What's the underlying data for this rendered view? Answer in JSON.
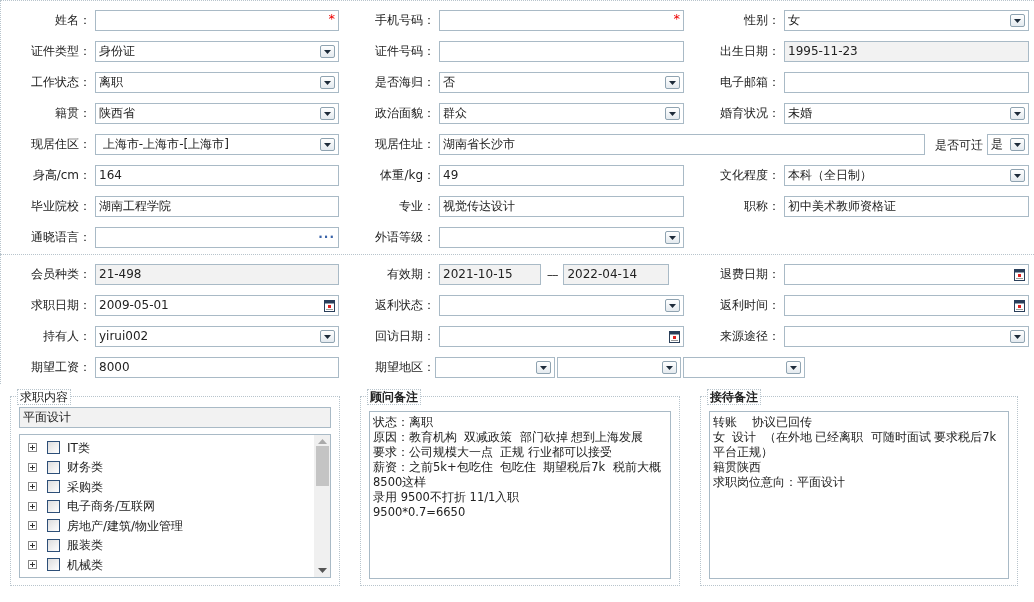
{
  "personal": {
    "fields": [
      {
        "label": "姓名：",
        "kind": "text",
        "required_mark": "*"
      },
      {
        "label": "手机号码：",
        "kind": "text",
        "required_mark": "*"
      },
      {
        "label": "性别：",
        "kind": "select",
        "value": "女"
      },
      {
        "label": "证件类型：",
        "kind": "select",
        "value": "身份证"
      },
      {
        "label": "证件号码：",
        "kind": "text"
      },
      {
        "label": "出生日期：",
        "kind": "text",
        "value": "1995-11-23",
        "readonly": true
      },
      {
        "label": "工作状态：",
        "kind": "select",
        "value": "离职"
      },
      {
        "label": "是否海归：",
        "kind": "select",
        "value": "否"
      },
      {
        "label": "电子邮箱：",
        "kind": "text"
      },
      {
        "label": "籍贯：",
        "kind": "select",
        "value": "陕西省"
      },
      {
        "label": "政治面貌：",
        "kind": "select",
        "value": "群众"
      },
      {
        "label": "婚育状况：",
        "kind": "select",
        "value": "未婚"
      },
      {
        "label": "现居住区：",
        "kind": "select",
        "value": " 上海市-上海市-[上海市]"
      },
      {
        "label": "现居住址：",
        "kind": "address",
        "value": "湖南省长沙市",
        "relocate": {
          "label": "是否可迁",
          "value": "是"
        }
      },
      {
        "label": "身高/cm：",
        "kind": "text",
        "value": "164"
      },
      {
        "label": "体重/kg：",
        "kind": "text",
        "value": "49"
      },
      {
        "label": "文化程度：",
        "kind": "select",
        "value": "本科（全日制）"
      },
      {
        "label": "毕业院校：",
        "kind": "text",
        "value": "湖南工程学院"
      },
      {
        "label": "专业：",
        "kind": "text",
        "value": "视觉传达设计"
      },
      {
        "label": "职称：",
        "kind": "text",
        "value": "初中美术教师资格证"
      },
      {
        "label": "通晓语言：",
        "kind": "lookup",
        "button": "···"
      },
      {
        "label": "外语等级：",
        "kind": "select"
      }
    ]
  },
  "membership": {
    "fields": [
      {
        "label": "会员种类：",
        "kind": "text",
        "value": "21-498",
        "readonly": true
      },
      {
        "label": "有效期：",
        "kind": "range",
        "from": "2021-10-15",
        "separator": "----",
        "to": "2022-04-14",
        "readonly": true
      },
      {
        "label": "退费日期：",
        "kind": "date"
      },
      {
        "label": "求职日期：",
        "kind": "date",
        "value": "2009-05-01"
      },
      {
        "label": "返利状态：",
        "kind": "select"
      },
      {
        "label": "返利时间：",
        "kind": "date"
      },
      {
        "label": "持有人：",
        "kind": "select",
        "value": "yirui002"
      },
      {
        "label": "回访日期：",
        "kind": "date"
      },
      {
        "label": "来源途径：",
        "kind": "select"
      },
      {
        "label": "期望工资：",
        "kind": "text",
        "value": "8000"
      },
      {
        "label": "期望地区：",
        "kind": "region"
      }
    ]
  },
  "job_content": {
    "title": "求职内容",
    "value": "平面设计",
    "tree": [
      {
        "label": "IT类",
        "expanded": false,
        "checked": false
      },
      {
        "label": "财务类",
        "expanded": false,
        "checked": false
      },
      {
        "label": "采购类",
        "expanded": false,
        "checked": false
      },
      {
        "label": "电子商务/互联网",
        "expanded": false,
        "checked": false
      },
      {
        "label": "房地产/建筑/物业管理",
        "expanded": false,
        "checked": false
      },
      {
        "label": "服装类",
        "expanded": false,
        "checked": false
      },
      {
        "label": "机械类",
        "expanded": false,
        "checked": false
      }
    ]
  },
  "consultant_notes": {
    "title": "顾问备注",
    "lines": [
      "状态：离职",
      "原因：教育机构  双减政策  部门砍掉 想到上海发展",
      "要求：公司规模大一点  正规 行业都可以接受",
      "薪资：之前5k+包吃住  包吃住  期望税后7k  税前大概8500这样",
      "录用 9500不打折 11/1入职",
      "9500*0.7=6650"
    ]
  },
  "reception_notes": {
    "title": "接待备注",
    "lines": [
      "转账    协议已回传",
      "女  设计  （在外地 已经离职  可随时面试 要求税后7k 平台正规）",
      "籍贯陕西",
      "求职岗位意向：平面设计"
    ]
  }
}
